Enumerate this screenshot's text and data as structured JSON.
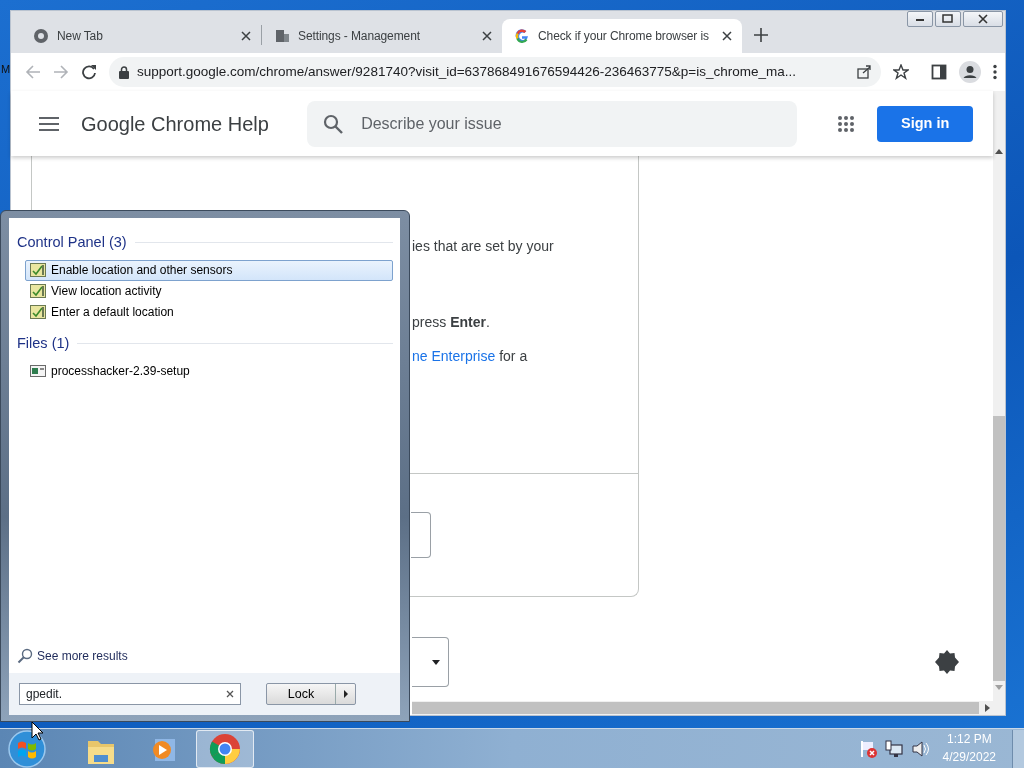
{
  "desktop": {
    "icon_label": "M"
  },
  "browser": {
    "tabs": [
      {
        "kind": "newtab",
        "title": "New Tab",
        "selected": false
      },
      {
        "kind": "settings",
        "title": "Settings - Management",
        "selected": false
      },
      {
        "kind": "google",
        "title": "Check if your Chrome browser is",
        "selected": true
      }
    ],
    "address": "support.google.com/chrome/answer/9281740?visit_id=637868491676594426-236463775&p=is_chrome_ma...",
    "header": {
      "title": "Google Chrome Help",
      "search_placeholder": "Describe your issue",
      "sign_in": "Sign in"
    },
    "article": {
      "line_1": "ies that are set by your",
      "line_2": "press **Enter**.",
      "line_3_link": "ne Enterprise",
      "line_3_rest": "for a"
    }
  },
  "start_menu": {
    "groups": [
      {
        "title": "Control Panel (3)",
        "items": [
          {
            "kind": "control_panel",
            "label": "Enable location and other sensors",
            "selected": true
          },
          {
            "kind": "control_panel",
            "label": "View location activity",
            "selected": false
          },
          {
            "kind": "control_panel",
            "label": "Enter a default location",
            "selected": false
          }
        ]
      },
      {
        "title": "Files (1)",
        "items": [
          {
            "kind": "file",
            "label": "processhacker-2.39-setup",
            "selected": false
          }
        ]
      }
    ],
    "see_more": "See more results",
    "search_value": "gpedit.",
    "power_button": "Lock"
  },
  "taskbar": {
    "apps": [
      {
        "kind": "explorer",
        "selected": false
      },
      {
        "kind": "media",
        "selected": false
      },
      {
        "kind": "chrome",
        "selected": true
      }
    ],
    "time": "1:12 PM",
    "date": "4/29/2022"
  }
}
